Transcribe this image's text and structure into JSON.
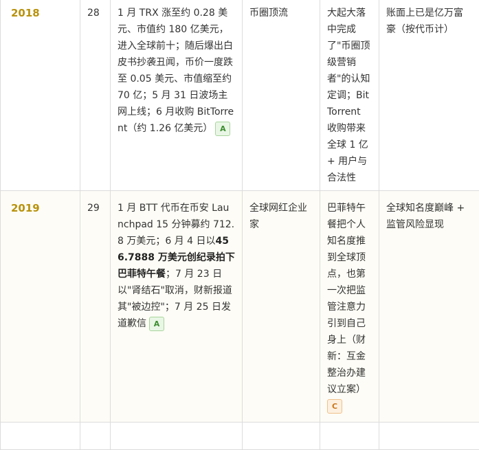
{
  "rows": [
    {
      "year": "2018",
      "age": "28",
      "events": "1 月 TRX 涨至约 0.28 美元、市值约 180 亿美元，进入全球前十；随后爆出白皮书抄袭丑闻，币价一度跌至 0.05 美元、市值缩至约 70 亿；5 月 31 日波场主网上线；6 月收购 BitTorrent（约 1.26 亿美元）",
      "events_grade": "A",
      "identity": "币圈顶流",
      "evaluation": "大起大落中完成了\"币圈顶级营销者\"的认知定调；BitTorrent 收购带来全球 1 亿 + 用户与合法性",
      "wealth": "账面上已是亿万富豪（按代币计）"
    },
    {
      "year": "2019",
      "age": "29",
      "events_pre": "1 月 BTT 代币在币安 Launchpad 15 分钟募约 712.8 万美元；6 月 4 日以",
      "events_bold": "456.7888 万美元创纪录拍下巴菲特午餐",
      "events_post": "；7 月 23 日以\"肾结石\"取消，财新报道其\"被边控\"；7 月 25 日发道歉信",
      "events_grade": "A",
      "identity": "全球网红企业家",
      "evaluation": "巴菲特午餐把个人知名度推到全球顶点，也第一次把监管注意力引到自己身上（财新：互金整治办建议立案）",
      "evaluation_grade": "C",
      "wealth": "全球知名度巅峰 + 监管风险显现"
    }
  ]
}
